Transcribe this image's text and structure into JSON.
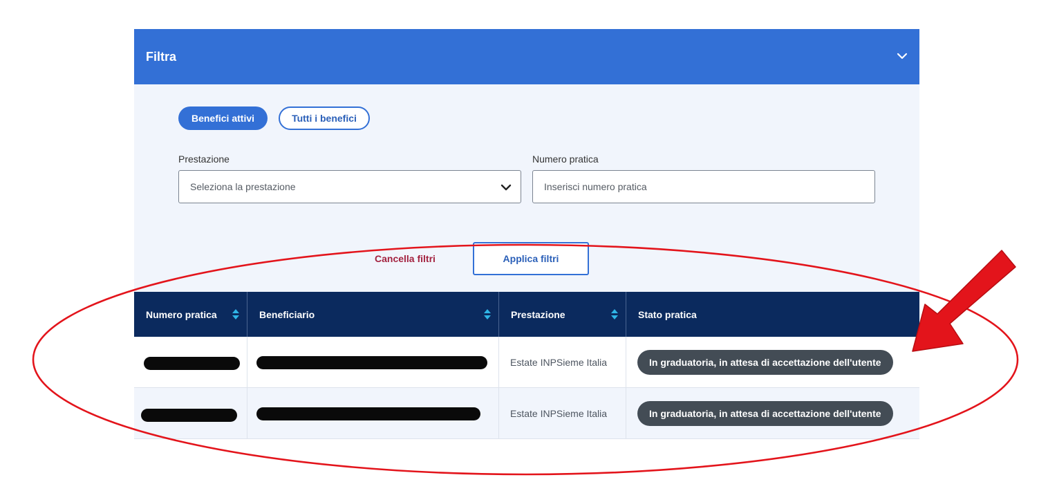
{
  "filter": {
    "title": "Filtra",
    "toggles": {
      "active": "Benefici attivi",
      "all": "Tutti i benefici"
    },
    "prestazione": {
      "label": "Prestazione",
      "value": "Seleziona la prestazione"
    },
    "numero_pratica": {
      "label": "Numero pratica",
      "placeholder": "Inserisci numero pratica"
    },
    "cancel_label": "Cancella filtri",
    "apply_label": "Applica filtri"
  },
  "table": {
    "headers": [
      "Numero pratica",
      "Beneficiario",
      "Prestazione",
      "Stato pratica"
    ],
    "rows": [
      {
        "numero_pratica": "",
        "beneficiario": "",
        "prestazione": "Estate INPSieme Italia",
        "stato": "In graduatoria, in attesa di accettazione dell'utente"
      },
      {
        "numero_pratica": "",
        "beneficiario": "",
        "prestazione": "Estate INPSieme Italia",
        "stato": "In graduatoria, in attesa di accettazione dell'utente"
      }
    ]
  },
  "colors": {
    "header_blue": "#3370d6",
    "table_header": "#0b2a5e",
    "panel_bg": "#f1f5fc",
    "cancel_red": "#a3223f",
    "badge_gray": "#434c55",
    "annotation_red": "#e3141b",
    "sort_icon": "#2fb5e6"
  },
  "icons": {
    "header": "chevron-down-icon",
    "select": "chevron-down-icon",
    "sort": "sort-arrows-icon"
  }
}
